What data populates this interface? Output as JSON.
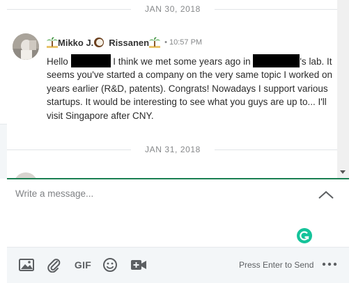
{
  "thread": {
    "date_separators": [
      "JAN 30, 2018",
      "JAN 31, 2018"
    ],
    "message": {
      "sender_first": "Mikko J.",
      "sender_last": "Rissanen",
      "sender_emojis": [
        "palm-tree-icon",
        "coconut-icon",
        "palm-tree-icon"
      ],
      "timestamp": "• 10:57 PM",
      "body_part1": "Hello ",
      "body_part2": " I think we met some years ago in ",
      "body_part3": "'s lab. It seems you've started a company on the very same topic I worked on years earlier (R&D, patents). Congrats! Nowadays I support various startups. It would be interesting to see what you guys are up to... I'll visit Singapore after CNY.",
      "redactions": 2
    }
  },
  "compose": {
    "placeholder": "Write a message...",
    "accent_color": "#1a7f52"
  },
  "toolbar": {
    "icons": [
      "image-icon",
      "attachment-icon",
      "gif-icon",
      "emoji-icon",
      "video-call-icon"
    ],
    "gif_label": "GIF",
    "hint": "Press Enter to Send",
    "more_icon": "more-options-icon"
  }
}
